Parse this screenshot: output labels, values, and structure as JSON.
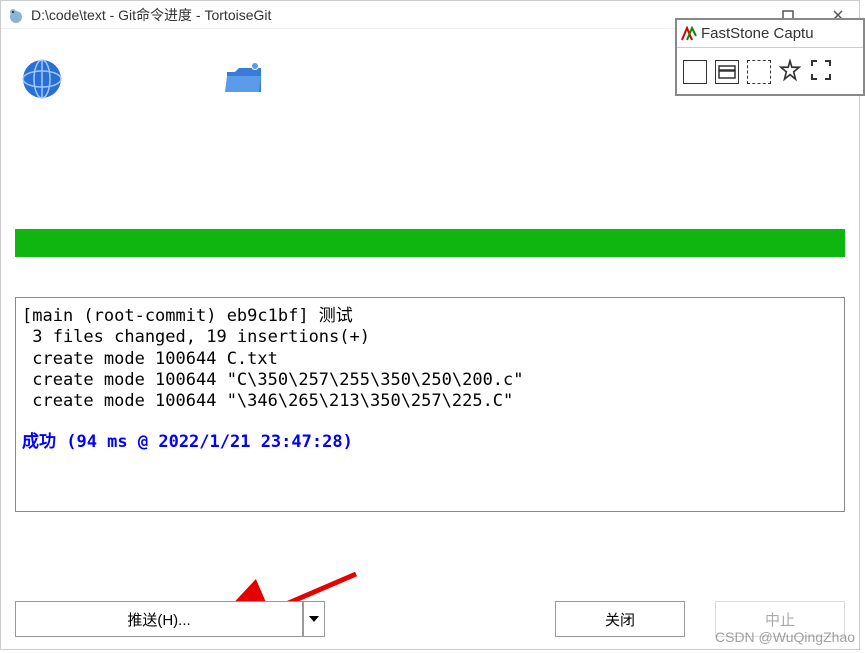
{
  "titlebar": {
    "title": "D:\\code\\text - Git命令进度 - TortoiseGit"
  },
  "output": {
    "line1": "[main (root-commit) eb9c1bf] 测试",
    "line2": " 3 files changed, 19 insertions(+)",
    "line3": " create mode 100644 C.txt",
    "line4": " create mode 100644 \"C\\350\\257\\255\\350\\250\\200.c\"",
    "line5": " create mode 100644 \"\\346\\265\\213\\350\\257\\225.C\"",
    "success_label": "成功",
    "success_detail": " (94 ms @ 2022/1/21 23:47:28)"
  },
  "buttons": {
    "push": "推送(H)...",
    "close": "关闭",
    "abort": "中止"
  },
  "faststone": {
    "title": "FastStone Captu"
  },
  "watermark": "CSDN @WuQingZhao"
}
